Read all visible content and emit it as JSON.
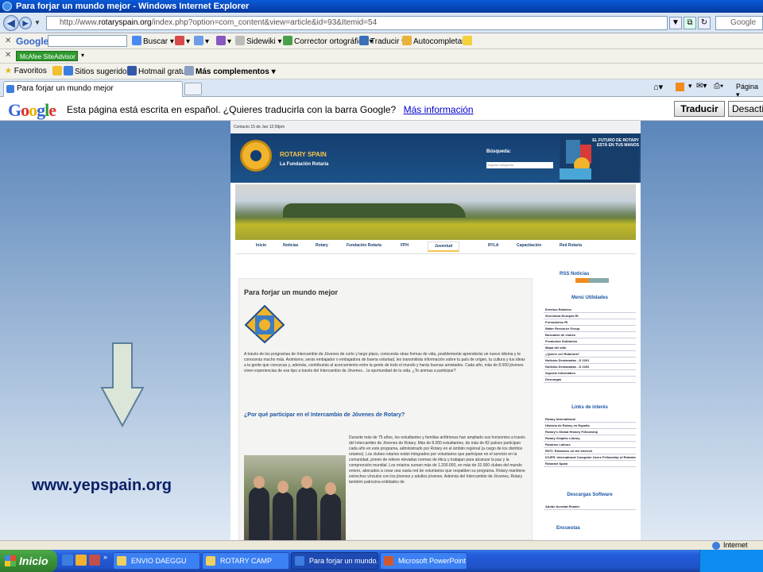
{
  "window": {
    "title": "Para forjar un mundo mejor - Windows Internet Explorer"
  },
  "address": {
    "url_prefix": "http://www.",
    "url_domain": "rotaryspain.org",
    "url_rest": "/index.php?option=com_content&view=article&id=93&Itemid=54",
    "search_placeholder": "Google"
  },
  "google_toolbar": {
    "label": "Google",
    "buscar": "Buscar",
    "sidewiki": "Sidewiki",
    "corrector": "Corrector ortográfico",
    "traducir": "Traducir",
    "autocompletar": "Autocompletar"
  },
  "mcafee": {
    "label": "McAfee SiteAdvisor"
  },
  "favorites": {
    "favoritos": "Favoritos",
    "sitios": "Sitios sugeridos",
    "hotmail": "Hotmail gratuito",
    "mas": "Más complementos"
  },
  "tabs": {
    "active_label": "Para forjar un mundo mejor",
    "pagina": "Página"
  },
  "translate_bar": {
    "logo": "Google",
    "message": "Esta página está escrita en español. ¿Quieres traducirla con la barra Google?",
    "more_info": "Más información",
    "translate_btn": "Traducir",
    "disable_btn": "Desactiv"
  },
  "slide": {
    "url_text": "www.yepspain.org"
  },
  "site": {
    "topbar": "Contacto  15 de Jan  12:59pm",
    "title": "ROTARY SPAIN",
    "subtitle": "La Fundación Rotaria",
    "search_label": "Búsqueda:",
    "search_placeholder": "Ingrese búsqueda",
    "future_text": "EL FUTURO DE ROTARY ESTÁ EN TUS MANOS",
    "nav": [
      "Inicio",
      "Noticias",
      "Rotary",
      "Fundación Rotaria",
      "FPH",
      "Juventud",
      "RYLA",
      "Capacitación",
      "Red Rotaria"
    ],
    "article_title": "Para forjar un mundo mejor",
    "para1": "A través de los programas de Intercambio de Jóvenes de corto y largo plazo, conocerás otras formas de vida, posiblemente aprenderás un nuevo idioma y te conocerás mucho más. Asimismo, serás embajador o embajadora de buena voluntad, les transmitirás información sobre tu país de origen, tu cultura y tus ideas a la gente que conozcas y, además, contribuirás al acercamiento entre la gente de todo el mundo y harás buenas amistades. Cada año, más de 8.000 jóvenes viven experiencias de ese tipo a través del Intercambio de Jóvenes... la oportunidad de tu vida. ¿Te animas a participar?",
    "section_title": "¿Por qué participar en el Intercambio de Jóvenes de Rotary?",
    "para2": "Durante más de 75 años, los estudiantes y familias anfitrionas han ampliado sus horizontes a través del Intercambio de Jóvenes de Rotary. Más de 8.000 estudiantes, de más de 82 países participan cada año en este programa, administrado por Rotary en el ámbito regional (a cargo de los distritos rotarios). Los clubes rotarios están integrados por voluntarios que participan en el servicio en la comunidad, ponen de relieve elevadas normas de ética y trabajan para alcanzar la paz y la comprensión mundial. Los rotarios suman más de 1.200.000, en más de 32.000 clubes del mundo entero, abocados a crear una vasta red de voluntarios que respalden su programa. Rotary mantiene estrechos vínculos con los jóvenes y adultos jóvenes. Además del Intercambio de Jóvenes, Rotary también patrocina entidades de",
    "rss": "RSS Noticias",
    "menu_title": "Menú Utilidades",
    "menu_items": [
      "Eventos Rotarios",
      "Secretaría Europea RI",
      "Formularios RI",
      "Water Resource Group",
      "Buscador de clubes",
      "Productos Solidarios",
      "Mapa del sitio",
      "¿Quiere ser Rotario/a?",
      "Noticias Destacadas - D 2201",
      "Noticias Destacadas - D 2202",
      "Soporte Informático",
      "Descargas"
    ],
    "links_title": "Links de interés",
    "links_items": [
      "Rotary International",
      "Historia de Rotary en España",
      "Rotary's Global History Fellowship",
      "Rotary Graphic Library",
      "Rotarios Latinos",
      "RDTI: Rotarians on the Internet",
      "ICUFR: International Computer Users Fellowship of Rotarians",
      "Rotaract Spain"
    ],
    "downloads_title": "Descargas Software",
    "downloads_items": [
      "Adobe Acrobat Reader"
    ],
    "polls_title": "Encuestas"
  },
  "status": {
    "zone": "Internet"
  },
  "taskbar": {
    "start": "Inicio",
    "tasks": [
      "ENVIO DAEGGU",
      "ROTARY CAMP",
      "Para forjar un mundo...",
      "Microsoft PowerPoint ..."
    ]
  }
}
